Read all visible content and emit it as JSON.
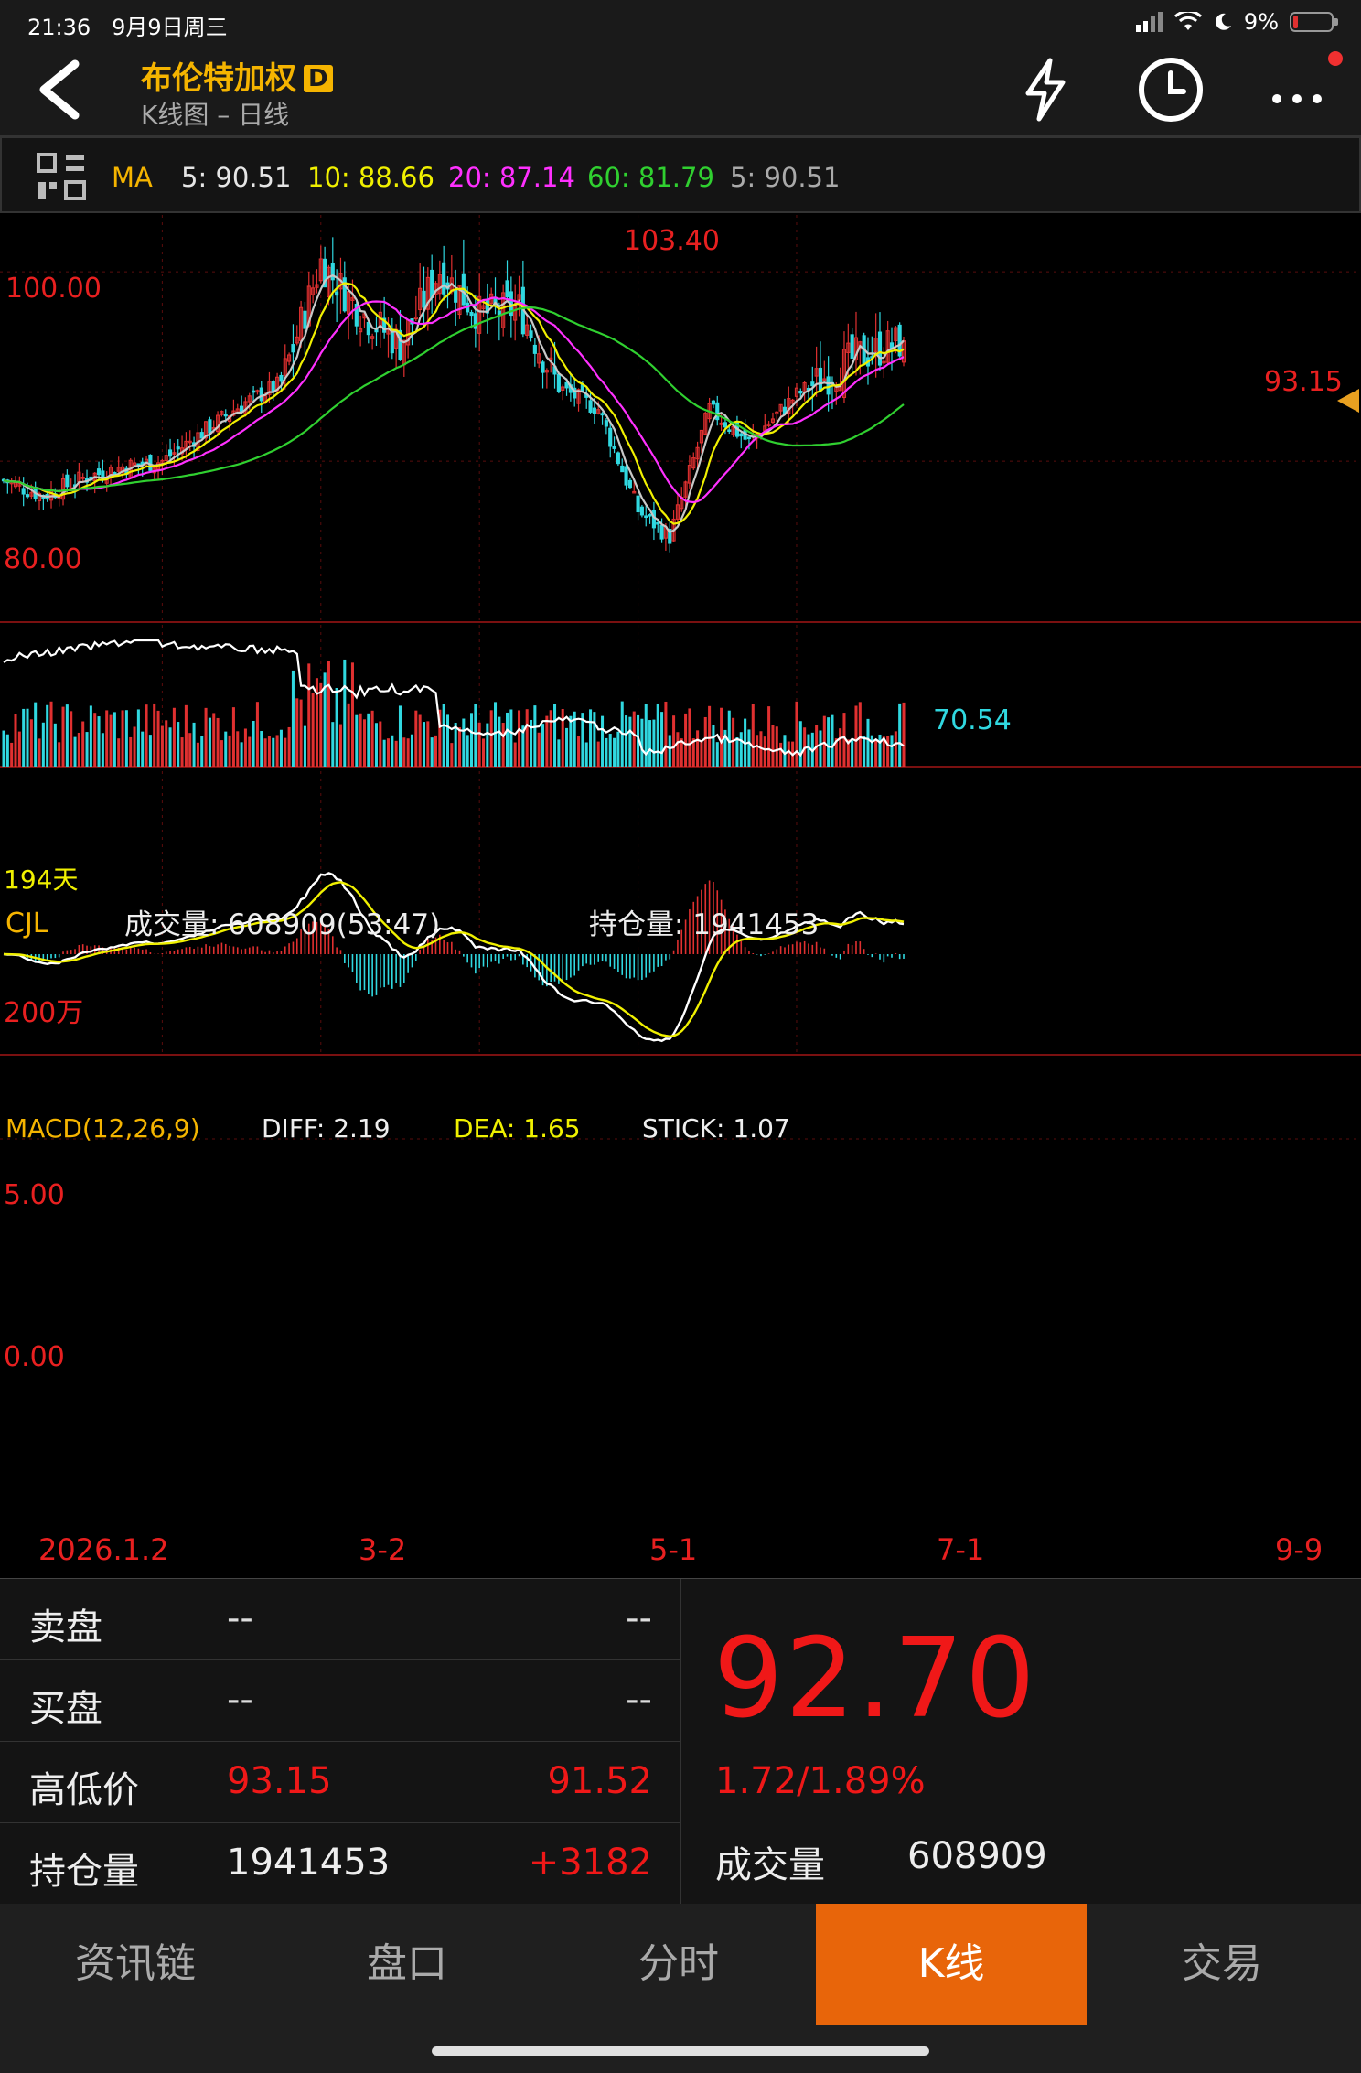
{
  "status": {
    "time": "21:36",
    "date": "9月9日周三",
    "battery": "9%"
  },
  "header": {
    "title": "布伦特加权",
    "badge": "D",
    "subtitle": "K线图 – 日线"
  },
  "ma": {
    "label": "MA",
    "ma5": "5: 90.51",
    "ma10": "10: 88.66",
    "ma20": "20: 87.14",
    "ma60": "60: 81.79",
    "ma5b": "5: 90.51"
  },
  "colors": {
    "up": "#e03030",
    "down": "#30d8e0",
    "ma5": "#c8c8c8",
    "ma10": "#f0f000",
    "ma20": "#ff30ff",
    "ma60": "#30d030",
    "accent": "#e8650a",
    "title": "#f5b400"
  },
  "price_panel": {
    "ylabels": [
      "100.00",
      "80.00"
    ],
    "high_label": "103.40",
    "low_label": "70.54",
    "last_label": "93.15",
    "corner_label": "194天"
  },
  "volume_panel": {
    "label": "CJL",
    "volume_text": "成交量: 608909(53:47)",
    "oi_text": "持仓量: 1941453",
    "ylabel": "200万"
  },
  "macd_panel": {
    "label": "MACD(12,26,9)",
    "diff": "DIFF: 2.19",
    "dea": "DEA: 1.65",
    "stick": "STICK: 1.07",
    "ylabels": [
      "5.00",
      "0.00"
    ]
  },
  "xaxis": [
    "2026.1.2",
    "3-2",
    "5-1",
    "7-1",
    "9-9"
  ],
  "chart_data": {
    "type": "candlestick",
    "title": "布伦特加权",
    "price_ylim": [
      63,
      106
    ],
    "close_anchors": [
      [
        0,
        78
      ],
      [
        10,
        76.3
      ],
      [
        20,
        78.2
      ],
      [
        30,
        79.4
      ],
      [
        40,
        80
      ],
      [
        60,
        86
      ],
      [
        70,
        88.2
      ],
      [
        80,
        101
      ],
      [
        90,
        95.8
      ],
      [
        100,
        92.4
      ],
      [
        110,
        100.2
      ],
      [
        120,
        95.5
      ],
      [
        130,
        96.2
      ],
      [
        140,
        87.8
      ],
      [
        150,
        85.5
      ],
      [
        160,
        74.8
      ],
      [
        168,
        72
      ],
      [
        178,
        85.5
      ],
      [
        188,
        82
      ],
      [
        200,
        87
      ],
      [
        215,
        91
      ],
      [
        227,
        92.7
      ]
    ],
    "high": 103.4,
    "low": 70.54,
    "last_high": 93.15,
    "last_close": 92.7,
    "ma": {
      "ma5": 90.51,
      "ma10": 88.66,
      "ma20": 87.14,
      "ma60": 81.79
    },
    "macd": {
      "diff": 2.19,
      "dea": 1.65,
      "stick": 1.07
    }
  },
  "orderbook": {
    "sell": {
      "label": "卖盘",
      "v1": "--",
      "v2": "--"
    },
    "buy": {
      "label": "买盘",
      "v1": "--",
      "v2": "--"
    },
    "hilo": {
      "label": "高低价",
      "v1": "93.15",
      "v2": "91.52"
    },
    "oi": {
      "label": "持仓量",
      "v1": "1941453",
      "v2": "+3182"
    }
  },
  "quote": {
    "price": "92.70",
    "change": "1.72/1.89%",
    "volume_label": "成交量",
    "volume": "608909"
  },
  "tabs": [
    "资讯链",
    "盘口",
    "分时",
    "K线",
    "交易"
  ],
  "active_tab": 3
}
